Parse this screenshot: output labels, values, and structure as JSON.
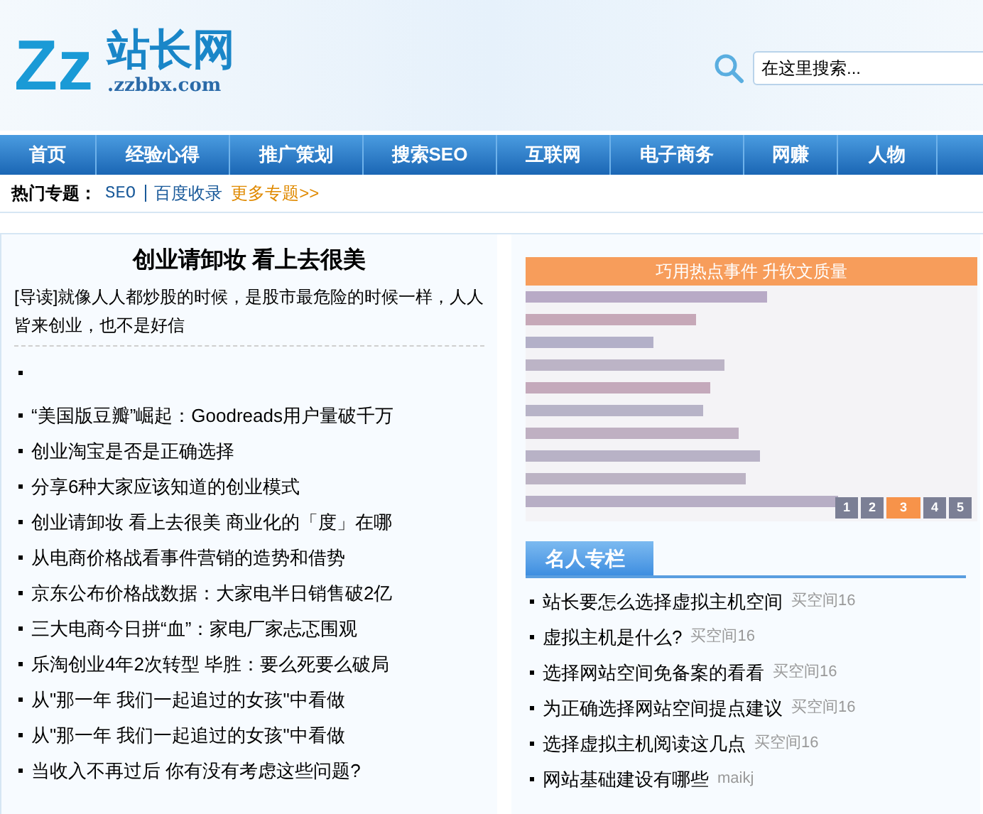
{
  "logo": {
    "mark": "Zz",
    "name": "站长网",
    "domain": ".zzbbx.com"
  },
  "search": {
    "placeholder": "在这里搜索..."
  },
  "nav": [
    {
      "label": "首页"
    },
    {
      "label": "经验心得"
    },
    {
      "label": "推广策划"
    },
    {
      "label": "搜索SEO"
    },
    {
      "label": "互联网"
    },
    {
      "label": "电子商务"
    },
    {
      "label": "网赚"
    },
    {
      "label": "人物"
    }
  ],
  "hot_topics": {
    "label": "热门专题：",
    "links": [
      {
        "text": "SEO",
        "kind": "mono"
      },
      {
        "text": "百度收录",
        "kind": "plain"
      }
    ],
    "more": "更多专题>>"
  },
  "feature": {
    "title": "创业请卸妆 看上去很美",
    "summary": "[导读]就像人人都炒股的时候，是股市最危险的时候一样，人人皆来创业，也不是好信"
  },
  "articles": [
    {
      "text": "“美国版豆瓣”崛起：Goodreads用户量破千万"
    },
    {
      "text": "创业淘宝是否是正确选择"
    },
    {
      "text": "分享6种大家应该知道的创业模式"
    },
    {
      "text": "创业请卸妆 看上去很美 商业化的「度」在哪"
    },
    {
      "text": "从电商价格战看事件营销的造势和借势"
    },
    {
      "text": "京东公布价格战数据：大家电半日销售破2亿"
    },
    {
      "text": "三大电商今日拼“血”：家电厂家忐忑围观"
    },
    {
      "text": "乐淘创业4年2次转型 毕胜：要么死要么破局"
    },
    {
      "text": "从\"那一年 我们一起追过的女孩\"中看做"
    },
    {
      "text": "从\"那一年 我们一起追过的女孩\"中看做"
    },
    {
      "text": "当收入不再过后 你有没有考虑这些问题?"
    }
  ],
  "slideshow": {
    "caption": "巧用热点事件 升软文质量",
    "pages": [
      {
        "label": "1",
        "selected": false
      },
      {
        "label": "2",
        "selected": false
      },
      {
        "label": "3",
        "selected": true
      },
      {
        "label": "4",
        "selected": false
      },
      {
        "label": "5",
        "selected": false
      }
    ]
  },
  "column": {
    "title": "名人专栏",
    "items": [
      {
        "text": "站长要怎么选择虚拟主机空间",
        "author": "买空间16"
      },
      {
        "text": "虚拟主机是什么?",
        "author": "买空间16"
      },
      {
        "text": "选择网站空间免备案的看看",
        "author": "买空间16"
      },
      {
        "text": "为正确选择网站空间提点建议",
        "author": "买空间16"
      },
      {
        "text": "选择虚拟主机阅读这几点",
        "author": "买空间16"
      },
      {
        "text": "网站基础建设有哪些",
        "author": "maikj"
      }
    ]
  }
}
